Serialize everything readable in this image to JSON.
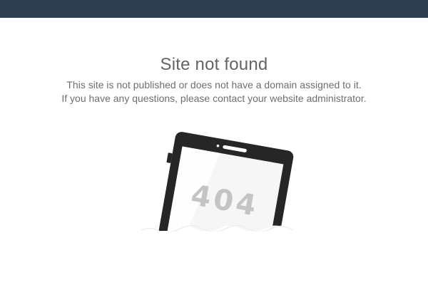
{
  "header": {
    "color": "#2c3e50"
  },
  "page": {
    "title": "Site not found",
    "message_line1": "This site is not published or does not have a domain assigned to it.",
    "message_line2": "If you have any questions, please contact your website administrator."
  },
  "illustration": {
    "label": "404",
    "icon": "tablet-sinking-404-icon"
  }
}
